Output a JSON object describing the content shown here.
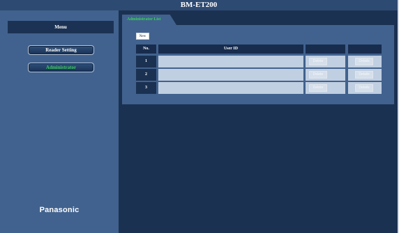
{
  "window": {
    "title": "BM-ET200"
  },
  "sidebar": {
    "menu_label": "Menu",
    "items": [
      {
        "label": "Reader Setting",
        "active": false
      },
      {
        "label": "Administrator",
        "active": true
      }
    ],
    "logo": "Panasonic"
  },
  "main": {
    "tab_label": "Administrator List",
    "new_button": "New",
    "table": {
      "headers": [
        "No.",
        "User ID",
        "",
        ""
      ],
      "rows": [
        {
          "no": "1",
          "user_id": "",
          "delete": "Delete",
          "details": "Details"
        },
        {
          "no": "2",
          "user_id": "",
          "delete": "Delete",
          "details": "Details"
        },
        {
          "no": "3",
          "user_id": "",
          "delete": "Delete",
          "details": "Details"
        }
      ]
    }
  },
  "colors": {
    "background": "#1b3152",
    "panel": "#41628e",
    "active_text": "#39d05a",
    "row_fill": "#c0cfe1"
  }
}
